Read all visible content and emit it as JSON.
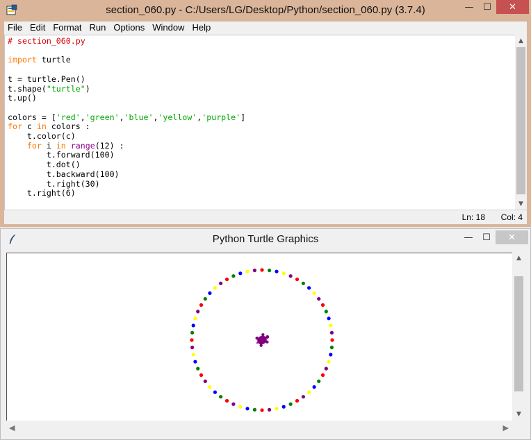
{
  "idle_window": {
    "title": "section_060.py - C:/Users/LG/Desktop/Python/section_060.py (3.7.4)",
    "controls": {
      "minimize": "—",
      "maximize": "☐",
      "close": "✕"
    },
    "menu": [
      "File",
      "Edit",
      "Format",
      "Run",
      "Options",
      "Window",
      "Help"
    ],
    "code_lines": [
      [
        {
          "t": "# section_060.py",
          "c": "cm"
        }
      ],
      [],
      [
        {
          "t": "import",
          "c": "kw"
        },
        {
          "t": " turtle",
          "c": ""
        }
      ],
      [],
      [
        {
          "t": "t = turtle.Pen()",
          "c": ""
        }
      ],
      [
        {
          "t": "t.shape(",
          "c": ""
        },
        {
          "t": "\"turtle\"",
          "c": "str"
        },
        {
          "t": ")",
          "c": ""
        }
      ],
      [
        {
          "t": "t.up()",
          "c": ""
        }
      ],
      [],
      [
        {
          "t": "colors = [",
          "c": ""
        },
        {
          "t": "'red'",
          "c": "str"
        },
        {
          "t": ",",
          "c": ""
        },
        {
          "t": "'green'",
          "c": "str"
        },
        {
          "t": ",",
          "c": ""
        },
        {
          "t": "'blue'",
          "c": "str"
        },
        {
          "t": ",",
          "c": ""
        },
        {
          "t": "'yellow'",
          "c": "str"
        },
        {
          "t": ",",
          "c": ""
        },
        {
          "t": "'purple'",
          "c": "str"
        },
        {
          "t": "]",
          "c": ""
        }
      ],
      [
        {
          "t": "for",
          "c": "kw"
        },
        {
          "t": " c ",
          "c": ""
        },
        {
          "t": "in",
          "c": "kw"
        },
        {
          "t": " colors :",
          "c": ""
        }
      ],
      [
        {
          "t": "    t.color(c)",
          "c": ""
        }
      ],
      [
        {
          "t": "    ",
          "c": ""
        },
        {
          "t": "for",
          "c": "kw"
        },
        {
          "t": " i ",
          "c": ""
        },
        {
          "t": "in",
          "c": "kw"
        },
        {
          "t": " ",
          "c": ""
        },
        {
          "t": "range",
          "c": "bi"
        },
        {
          "t": "(12) :",
          "c": ""
        }
      ],
      [
        {
          "t": "        t.forward(100)",
          "c": ""
        }
      ],
      [
        {
          "t": "        t.dot()",
          "c": ""
        }
      ],
      [
        {
          "t": "        t.backward(100)",
          "c": ""
        }
      ],
      [
        {
          "t": "        t.right(30)",
          "c": ""
        }
      ],
      [
        {
          "t": "    t.right(6)",
          "c": ""
        }
      ]
    ],
    "status": {
      "ln": "Ln: 18",
      "col": "Col: 4"
    }
  },
  "turtle_window": {
    "title": "Python Turtle Graphics",
    "controls": {
      "minimize": "—",
      "maximize": "☐",
      "close": "✕"
    },
    "colors": {
      "red": "#ff0000",
      "green": "#008000",
      "blue": "#0000ff",
      "yellow": "#ffff00",
      "purple": "#800080"
    },
    "drawing": {
      "color_order": [
        "red",
        "green",
        "blue",
        "yellow",
        "purple"
      ],
      "dots_per_color": 12,
      "turn_between_dots_deg": 30,
      "turn_between_colors_deg": 6,
      "radius": 100,
      "turtle_color": "purple"
    }
  }
}
